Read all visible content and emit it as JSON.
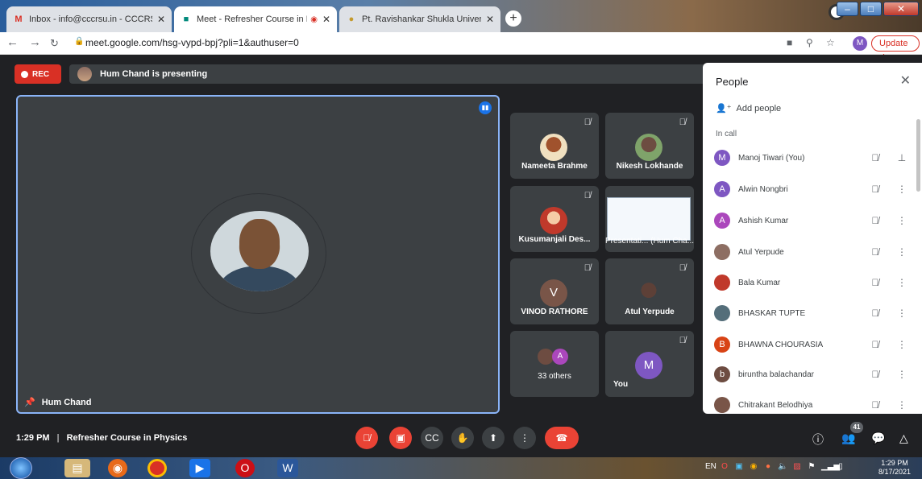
{
  "browser": {
    "tabs": [
      {
        "title": "Inbox - info@cccrsu.in - CCCRSU",
        "icon": "gmail-icon"
      },
      {
        "title": "Meet - Refresher Course in P",
        "icon": "meet-icon"
      },
      {
        "title": "Pt. Ravishankar Shukla University",
        "icon": "university-icon"
      }
    ],
    "new_tab": "+",
    "url": "meet.google.com/hsg-vypd-bpj?pli=1&authuser=0",
    "profile_initial": "M",
    "update_label": "Update"
  },
  "meet": {
    "rec_label": "REC",
    "presenting_text": "Hum Chand is presenting",
    "main_tile_name": "Hum Chand",
    "tiles": [
      {
        "name": "Nameeta Brahme"
      },
      {
        "name": "Nikesh Lokhande"
      },
      {
        "name": "Kusumanjali Des..."
      },
      {
        "name": "Presentati... (Hum Cha..."
      },
      {
        "name": "VINOD RATHORE",
        "initial": "V"
      },
      {
        "name": "Atul Yerpude"
      },
      {
        "name": "33 others",
        "initial": "A"
      },
      {
        "name": "You",
        "initial": "M"
      }
    ],
    "people_panel": {
      "title": "People",
      "add_people": "Add people",
      "in_call": "In call",
      "participants": [
        {
          "name": "Manoj Tiwari (You)",
          "initial": "M",
          "color": "#7e57c2"
        },
        {
          "name": "Alwin Nongbri",
          "initial": "A",
          "color": "#7e57c2"
        },
        {
          "name": "Ashish Kumar",
          "initial": "A",
          "color": "#ab47bc"
        },
        {
          "name": "Atul Yerpude",
          "initial": "",
          "color": "#8d6e63"
        },
        {
          "name": "Bala Kumar",
          "initial": "",
          "color": "#c0392b"
        },
        {
          "name": "BHASKAR TUPTE",
          "initial": "",
          "color": "#546e7a"
        },
        {
          "name": "BHAWNA CHOURASIA",
          "initial": "B",
          "color": "#d84315"
        },
        {
          "name": "biruntha balachandar",
          "initial": "b",
          "color": "#6d4c41"
        },
        {
          "name": "Chitrakant Belodhiya",
          "initial": "",
          "color": "#795548"
        }
      ]
    },
    "bottom": {
      "time": "1:29 PM",
      "separator": "|",
      "meeting_name": "Refresher Course in Physics",
      "participant_count": "41"
    }
  },
  "taskbar": {
    "lang": "EN",
    "clock_time": "1:29 PM",
    "clock_date": "8/17/2021"
  }
}
